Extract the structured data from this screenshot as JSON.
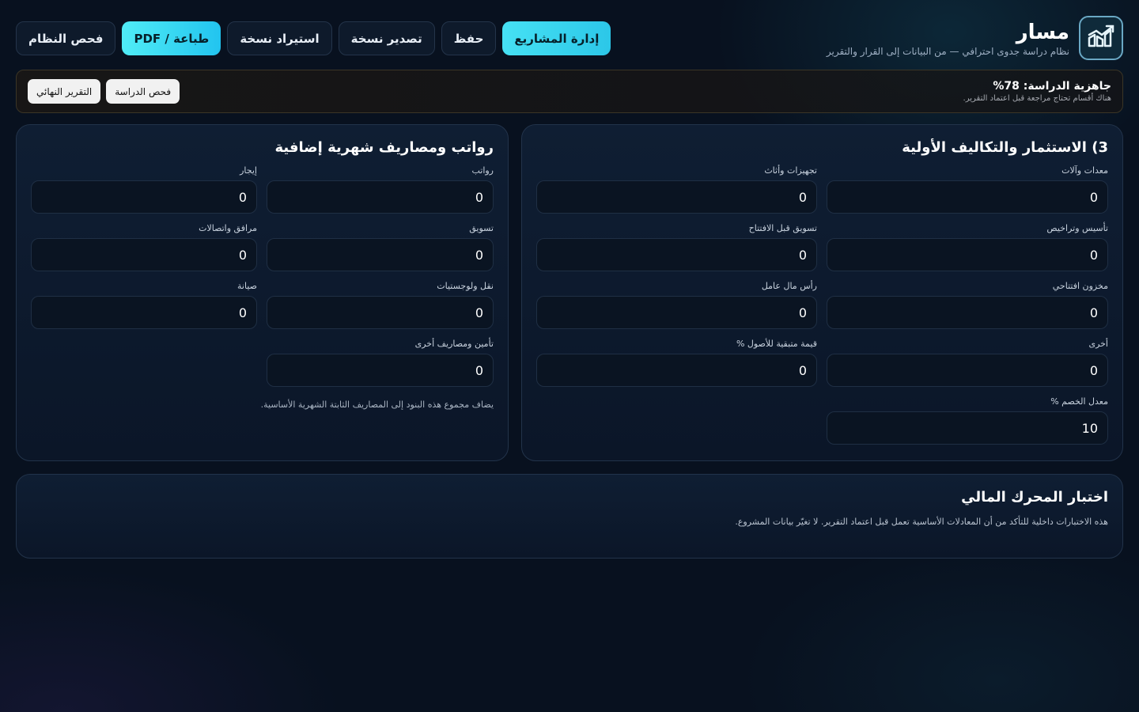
{
  "brand": {
    "title": "مسار",
    "subtitle": "نظام دراسة جدوى احترافي — من البيانات إلى القرار والتقرير",
    "logo_icon": "chart-growth-icon"
  },
  "toolbar": {
    "projects": "إدارة المشاريع",
    "save": "حفظ",
    "export": "تصدير نسخة",
    "import": "استيراد نسخة",
    "print": "طباعة / PDF",
    "system_check": "فحص النظام"
  },
  "readiness": {
    "title": "جاهزية الدراسة: 78%",
    "subtitle": "هناك أقسام تحتاج مراجعة قبل اعتماد التقرير.",
    "study_check": "فحص الدراسة",
    "final_report": "التقرير النهائي"
  },
  "investment": {
    "title": "3) الاستثمار والتكاليف الأولية",
    "fields": [
      {
        "label": "معدات وآلات",
        "value": "0"
      },
      {
        "label": "تجهيزات وأثاث",
        "value": "0"
      },
      {
        "label": "تأسيس وتراخيص",
        "value": "0"
      },
      {
        "label": "تسويق قبل الافتتاح",
        "value": "0"
      },
      {
        "label": "مخزون افتتاحي",
        "value": "0"
      },
      {
        "label": "رأس مال عامل",
        "value": "0"
      },
      {
        "label": "أخرى",
        "value": "0"
      },
      {
        "label": "قيمة متبقية للأصول %",
        "value": "0"
      },
      {
        "label": "معدل الخصم %",
        "value": "10"
      }
    ]
  },
  "salaries": {
    "title": "رواتب ومصاريف شهرية إضافية",
    "fields": [
      {
        "label": "رواتب",
        "value": "0"
      },
      {
        "label": "إيجار",
        "value": "0"
      },
      {
        "label": "تسويق",
        "value": "0"
      },
      {
        "label": "مرافق واتصالات",
        "value": "0"
      },
      {
        "label": "نقل ولوجستيات",
        "value": "0"
      },
      {
        "label": "صيانة",
        "value": "0"
      },
      {
        "label": "تأمين ومصاريف أخرى",
        "value": "0"
      }
    ],
    "note": "يضاف مجموع هذه البنود إلى المصاريف الثابتة الشهرية الأساسية."
  },
  "engine_test": {
    "title": "اختبار المحرك المالي",
    "description": "هذه الاختبارات داخلية للتأكد من أن المعادلات الأساسية تعمل قبل اعتماد التقرير. لا تغيّر بيانات المشروع."
  }
}
